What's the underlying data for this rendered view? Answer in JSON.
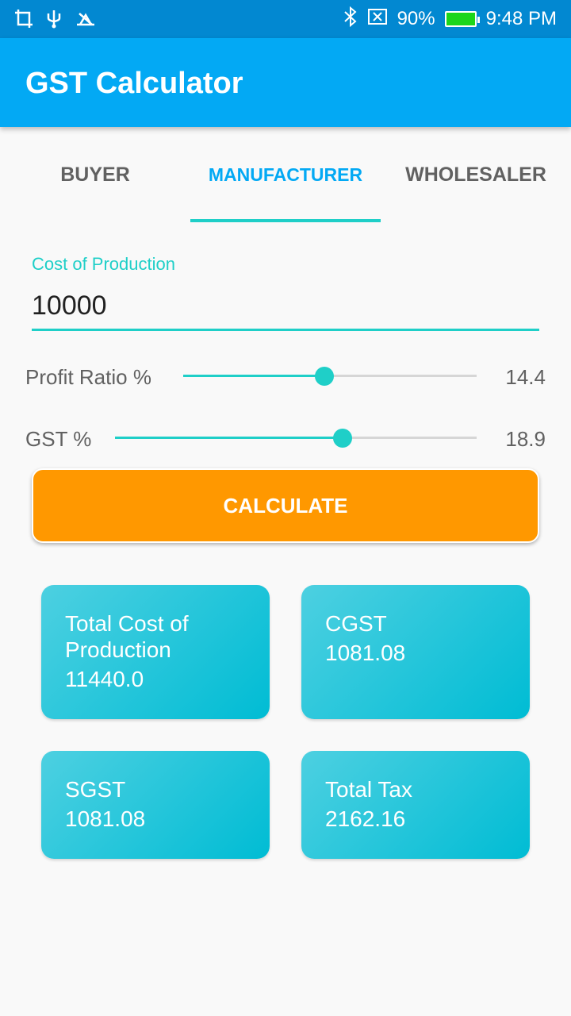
{
  "status_bar": {
    "battery": "90%",
    "time": "9:48 PM",
    "icons": [
      "crop-icon",
      "usb-icon",
      "usb-debug-icon",
      "bluetooth-icon",
      "no-sim-icon",
      "battery-icon"
    ]
  },
  "app_bar": {
    "title": "GST Calculator"
  },
  "tabs": [
    {
      "label": "BUYER"
    },
    {
      "label": "MANUFACTURER"
    },
    {
      "label": "WHOLESALER"
    }
  ],
  "active_tab": "MANUFACTURER",
  "cost_field": {
    "label": "Cost of Production",
    "value": "10000"
  },
  "profit_slider": {
    "label": "Profit Ratio %",
    "value": "14.4",
    "fraction": 0.48
  },
  "gst_slider": {
    "label": "GST %",
    "value": "18.9",
    "fraction": 0.63
  },
  "calculate_button": {
    "label": "CALCULATE"
  },
  "results": [
    {
      "label": "Total Cost of Production",
      "value": "11440.0"
    },
    {
      "label": "CGST",
      "value": "1081.08"
    },
    {
      "label": "SGST",
      "value": "1081.08"
    },
    {
      "label": "Total Tax",
      "value": "2162.16"
    }
  ],
  "colors": {
    "status_bar": "#0288d1",
    "app_bar": "#03a9f4",
    "accent": "#1fcfc8",
    "button": "#ff9800",
    "card": "#26c6da"
  }
}
